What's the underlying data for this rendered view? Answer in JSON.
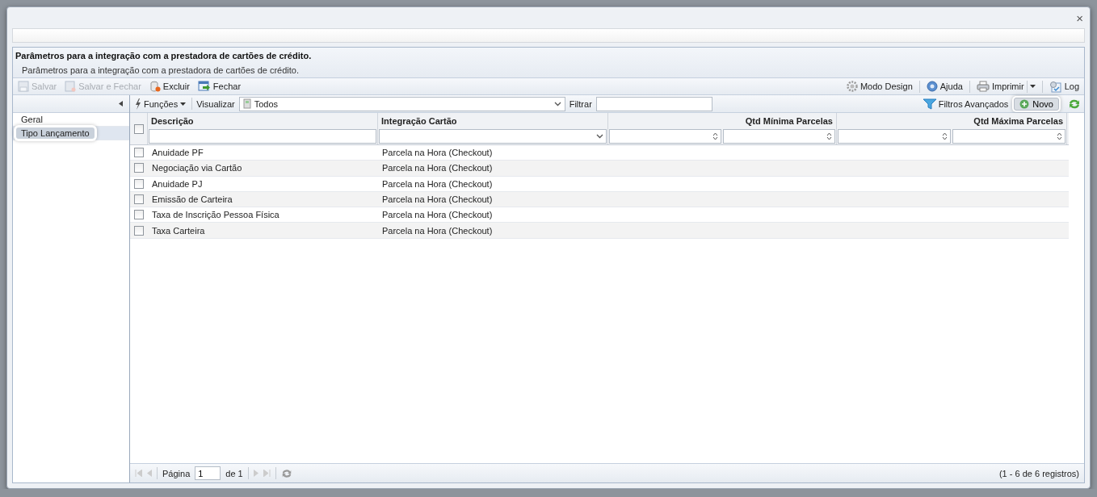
{
  "window": {
    "close": "×"
  },
  "header": {
    "title": "Parâmetros para a integração com a prestadora de cartões de crédito.",
    "subtitle": "Parâmetros para a integração com a prestadora de cartões de crédito."
  },
  "toolbar": {
    "left": [
      {
        "label": "Salvar",
        "disabled": true
      },
      {
        "label": "Salvar e Fechar",
        "disabled": true
      },
      {
        "label": "Excluir",
        "disabled": false
      },
      {
        "label": "Fechar",
        "disabled": false
      }
    ],
    "right": [
      {
        "label": "Modo Design",
        "dropdown": false
      },
      {
        "label": "Ajuda",
        "dropdown": false
      },
      {
        "label": "Imprimir",
        "dropdown": true
      },
      {
        "label": "Log",
        "dropdown": false
      }
    ]
  },
  "sidebar": {
    "items": [
      {
        "label": "Geral",
        "selected": false
      },
      {
        "label": "Tipo Lançamento",
        "selected": true
      }
    ]
  },
  "grid_toolbar": {
    "functions": "Funções",
    "view_label": "Visualizar",
    "view_value": "Todos",
    "filter_label": "Filtrar",
    "advanced": "Filtros Avançados",
    "new": "Novo"
  },
  "grid": {
    "select_all": false,
    "columns": [
      {
        "label": "Descrição",
        "kind": "text"
      },
      {
        "label": "Integração Cartão",
        "kind": "select"
      },
      {
        "label": "Qtd Mínima Parcelas",
        "kind": "number"
      },
      {
        "label": "Qtd Máxima Parcelas",
        "kind": "number"
      }
    ],
    "rows": [
      {
        "checked": false,
        "cells": [
          "Anuidade PF",
          "Parcela na Hora (Checkout)"
        ]
      },
      {
        "checked": false,
        "cells": [
          "Negociação via Cartão",
          "Parcela na Hora (Checkout)"
        ]
      },
      {
        "checked": false,
        "cells": [
          "Anuidade PJ",
          "Parcela na Hora (Checkout)"
        ]
      },
      {
        "checked": false,
        "cells": [
          "Emissão de Carteira",
          "Parcela na Hora (Checkout)"
        ]
      },
      {
        "checked": false,
        "cells": [
          "Taxa de Inscrição Pessoa Física",
          "Parcela na Hora (Checkout)"
        ]
      },
      {
        "checked": false,
        "cells": [
          "Taxa Carteira",
          "Parcela na Hora (Checkout)"
        ]
      }
    ]
  },
  "paging": {
    "page_label": "Página",
    "page_value": "1",
    "page_of": "de 1",
    "summary": "(1 - 6 de 6 registros)"
  }
}
